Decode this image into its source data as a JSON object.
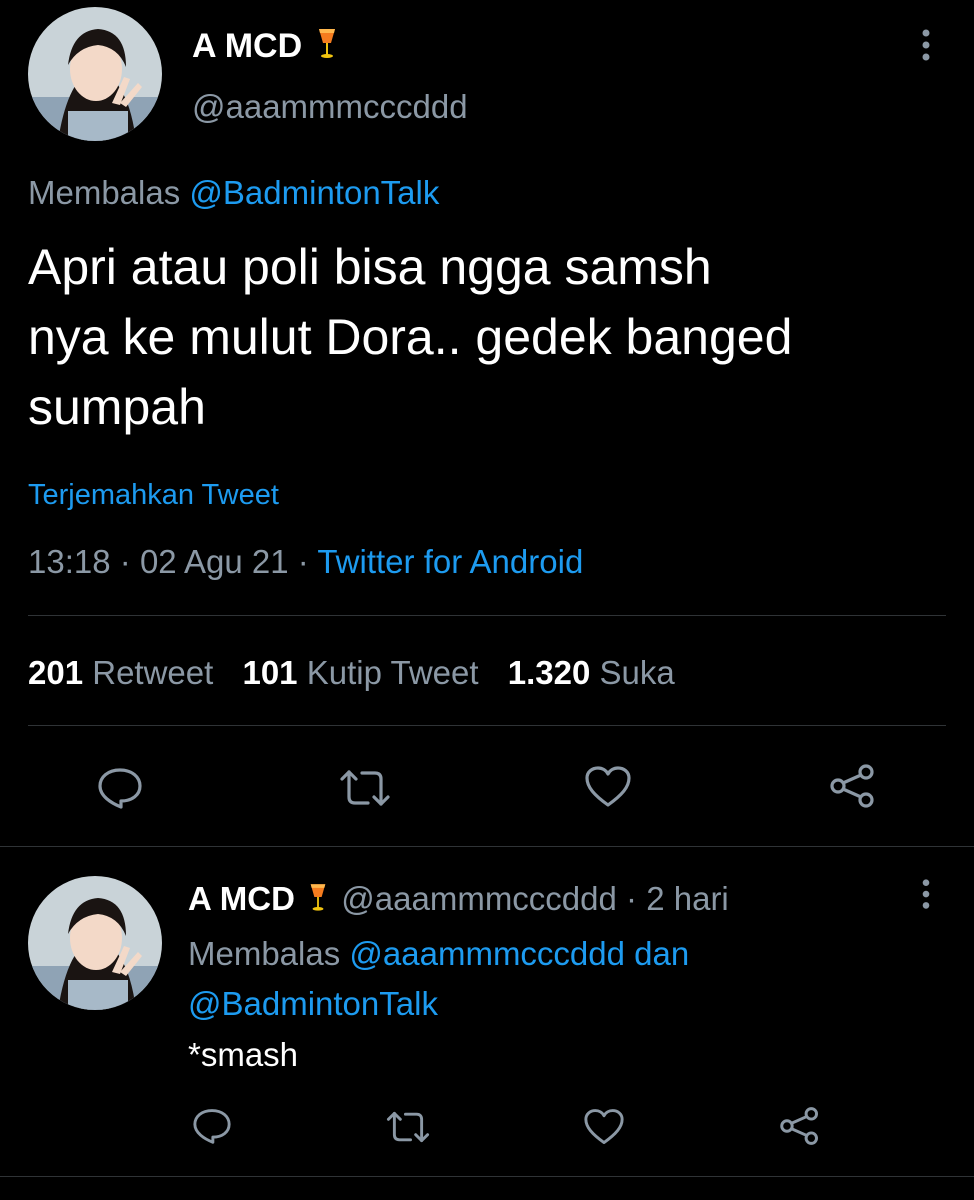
{
  "main_tweet": {
    "display_name": "A MCD",
    "handle": "@aaammmcccddd",
    "replying_label": "Membalas",
    "replying_to": "@BadmintonTalk",
    "text_line1": "Apri atau poli bisa ngga samsh",
    "text_line2": "nya ke mulut Dora.. gedek banged",
    "text_line3": "sumpah",
    "translate_label": "Terjemahkan Tweet",
    "time": "13:18",
    "date": "02 Agu 21",
    "separator": "·",
    "source": "Twitter for Android",
    "retweet_count": "201",
    "retweet_label": "Retweet",
    "quote_count": "101",
    "quote_label": "Kutip Tweet",
    "like_count": "1.320",
    "like_label": "Suka"
  },
  "reply_tweet": {
    "display_name": "A MCD",
    "handle": "@aaammmcccddd",
    "separator": "·",
    "age": "2 hari",
    "replying_label": "Membalas",
    "replying_to_1": "@aaammmcccddd",
    "conjunction": "dan",
    "replying_to_2": "@BadmintonTalk",
    "text": "*smash"
  },
  "icons": {
    "name_emoji": "tropical-drink-emoji",
    "more": "more-vertical-icon",
    "reply": "reply-icon",
    "retweet": "retweet-icon",
    "like": "heart-icon",
    "share": "share-icon"
  },
  "colors": {
    "background": "#000000",
    "text": "#e7e9ea",
    "secondary": "#8b98a5",
    "accent": "#1d9bf0",
    "divider": "#2f3336"
  }
}
